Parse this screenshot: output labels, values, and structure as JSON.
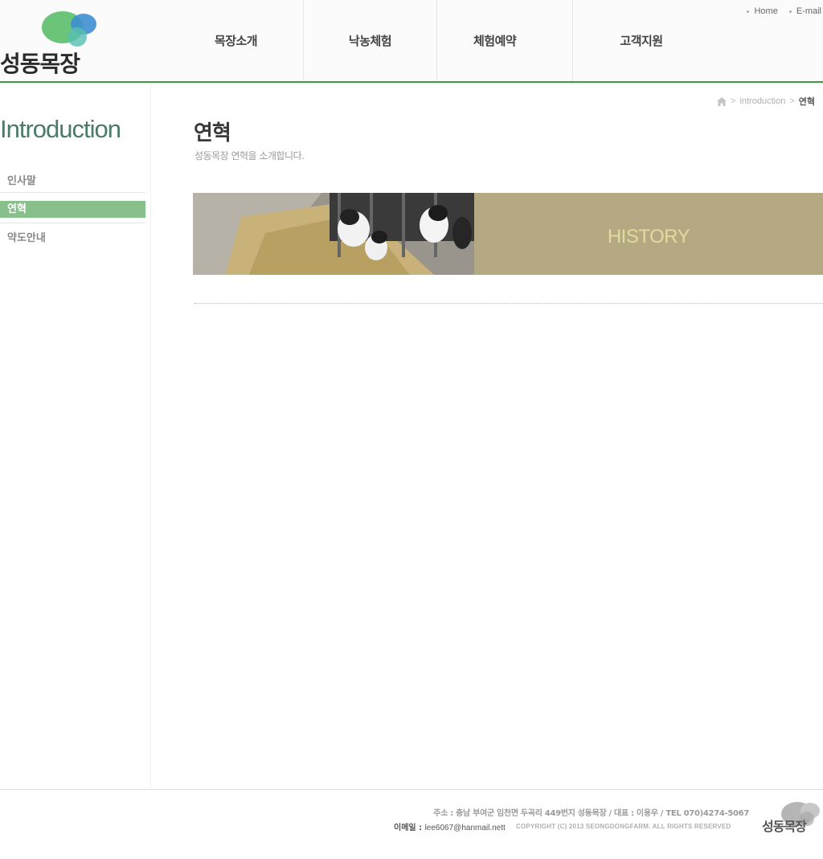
{
  "brand": {
    "name": "성동목장"
  },
  "util_links": [
    {
      "label": "Home"
    },
    {
      "label": "E-mail"
    }
  ],
  "gnb": [
    {
      "label": "목장소개"
    },
    {
      "label": "낙농체험"
    },
    {
      "label": "체험예약"
    },
    {
      "label": "고객지원"
    }
  ],
  "sidebar": {
    "title": "Introduction",
    "items": [
      {
        "label": "인사말",
        "active": false
      },
      {
        "label": "연혁",
        "active": true
      },
      {
        "label": "약도안내",
        "active": false
      }
    ]
  },
  "breadcrumb": {
    "section": "introduction",
    "current": "연혁"
  },
  "page": {
    "title": "연혁",
    "subtitle": "성동목장 연혁을 소개합니다."
  },
  "banner": {
    "label": "HISTORY"
  },
  "footer": {
    "address": "주소 : 충남 부여군 임천면 두곡리 449번지 성동목장 /  대표 : 이용우  / TEL  070)4274-5067",
    "email_label": "이메일  :",
    "email_value": "lee6067@hanmail.nett",
    "copyright": "COPYRIGHT (C) 2013 SEONGDONGFARM. ALL RIGHTS RESERVED",
    "logo_text": "성동목장"
  },
  "colors": {
    "accent_green": "#3aa13a",
    "menu_active": "#88c08c",
    "banner_tan": "#b4a982",
    "sidebar_title": "#4a7a6a"
  }
}
